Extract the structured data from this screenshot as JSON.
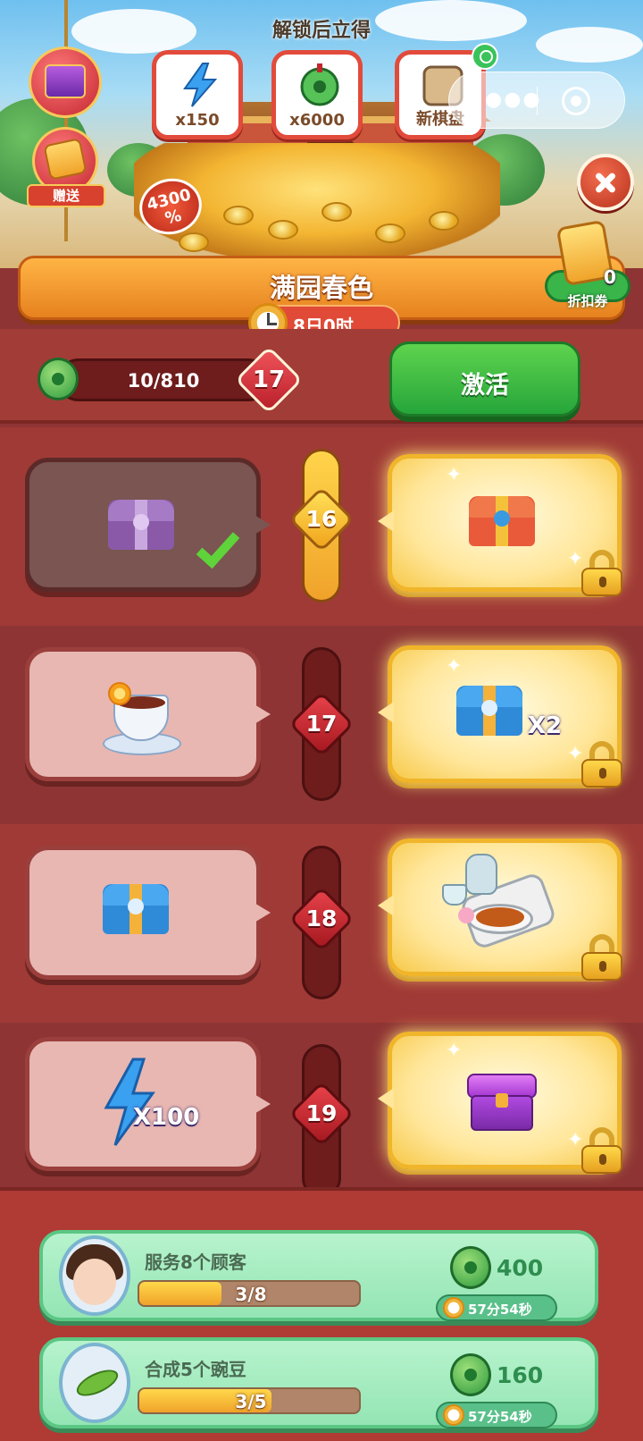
{
  "header": {
    "unlock_title": "解锁后立得",
    "unlock_rewards": [
      {
        "icon": "energy-bolt-icon",
        "label": "x150"
      },
      {
        "icon": "jade-coin-icon",
        "label": "x6000"
      },
      {
        "icon": "new-board-icon",
        "label": "新棋盘"
      }
    ],
    "gift_label": "赠送",
    "percent_badge": {
      "line1": "4300",
      "line2": "%"
    },
    "close_icon": "close-icon"
  },
  "event": {
    "title": "满园春色",
    "time_left": "8日0时",
    "coupon": {
      "count": "0",
      "label": "折扣券"
    }
  },
  "progress": {
    "text": "10/810",
    "current_level": "17",
    "progress_fraction": 0.0123,
    "activate_label": "激活"
  },
  "tiers": [
    {
      "level": "16",
      "free_item": "purple-chest-icon",
      "free_claimed": true,
      "premium_item": "red-chest-icon",
      "premium_qty": "",
      "premium_locked": true,
      "track_filled": true
    },
    {
      "level": "17",
      "free_item": "tea-cup-icon",
      "free_claimed": false,
      "premium_item": "blue-chest-icon",
      "premium_qty": "X2",
      "premium_locked": true,
      "track_filled": false
    },
    {
      "level": "18",
      "free_item": "blue-chest-icon",
      "free_claimed": false,
      "premium_item": "food-tray-icon",
      "premium_qty": "",
      "premium_locked": true,
      "track_filled": false
    },
    {
      "level": "19",
      "free_item": "energy-bolt-icon",
      "free_qty": "X100",
      "free_claimed": false,
      "premium_item": "purple-box-icon",
      "premium_qty": "",
      "premium_locked": true,
      "track_filled": false
    }
  ],
  "tasks": [
    {
      "name": "服务8个顾客",
      "progress_text": "3/8",
      "progress_fraction": 0.375,
      "reward": "400",
      "timer": "57分54秒",
      "icon": "customer-avatar"
    },
    {
      "name": "合成5个豌豆",
      "progress_text": "3/5",
      "progress_fraction": 0.6,
      "reward": "160",
      "timer": "57分54秒",
      "icon": "pea-pod-icon"
    }
  ],
  "colors": {
    "background": "#8e3434",
    "accent_green": "#26a53a",
    "accent_orange": "#e6821f",
    "gold": "#f0b52a"
  }
}
